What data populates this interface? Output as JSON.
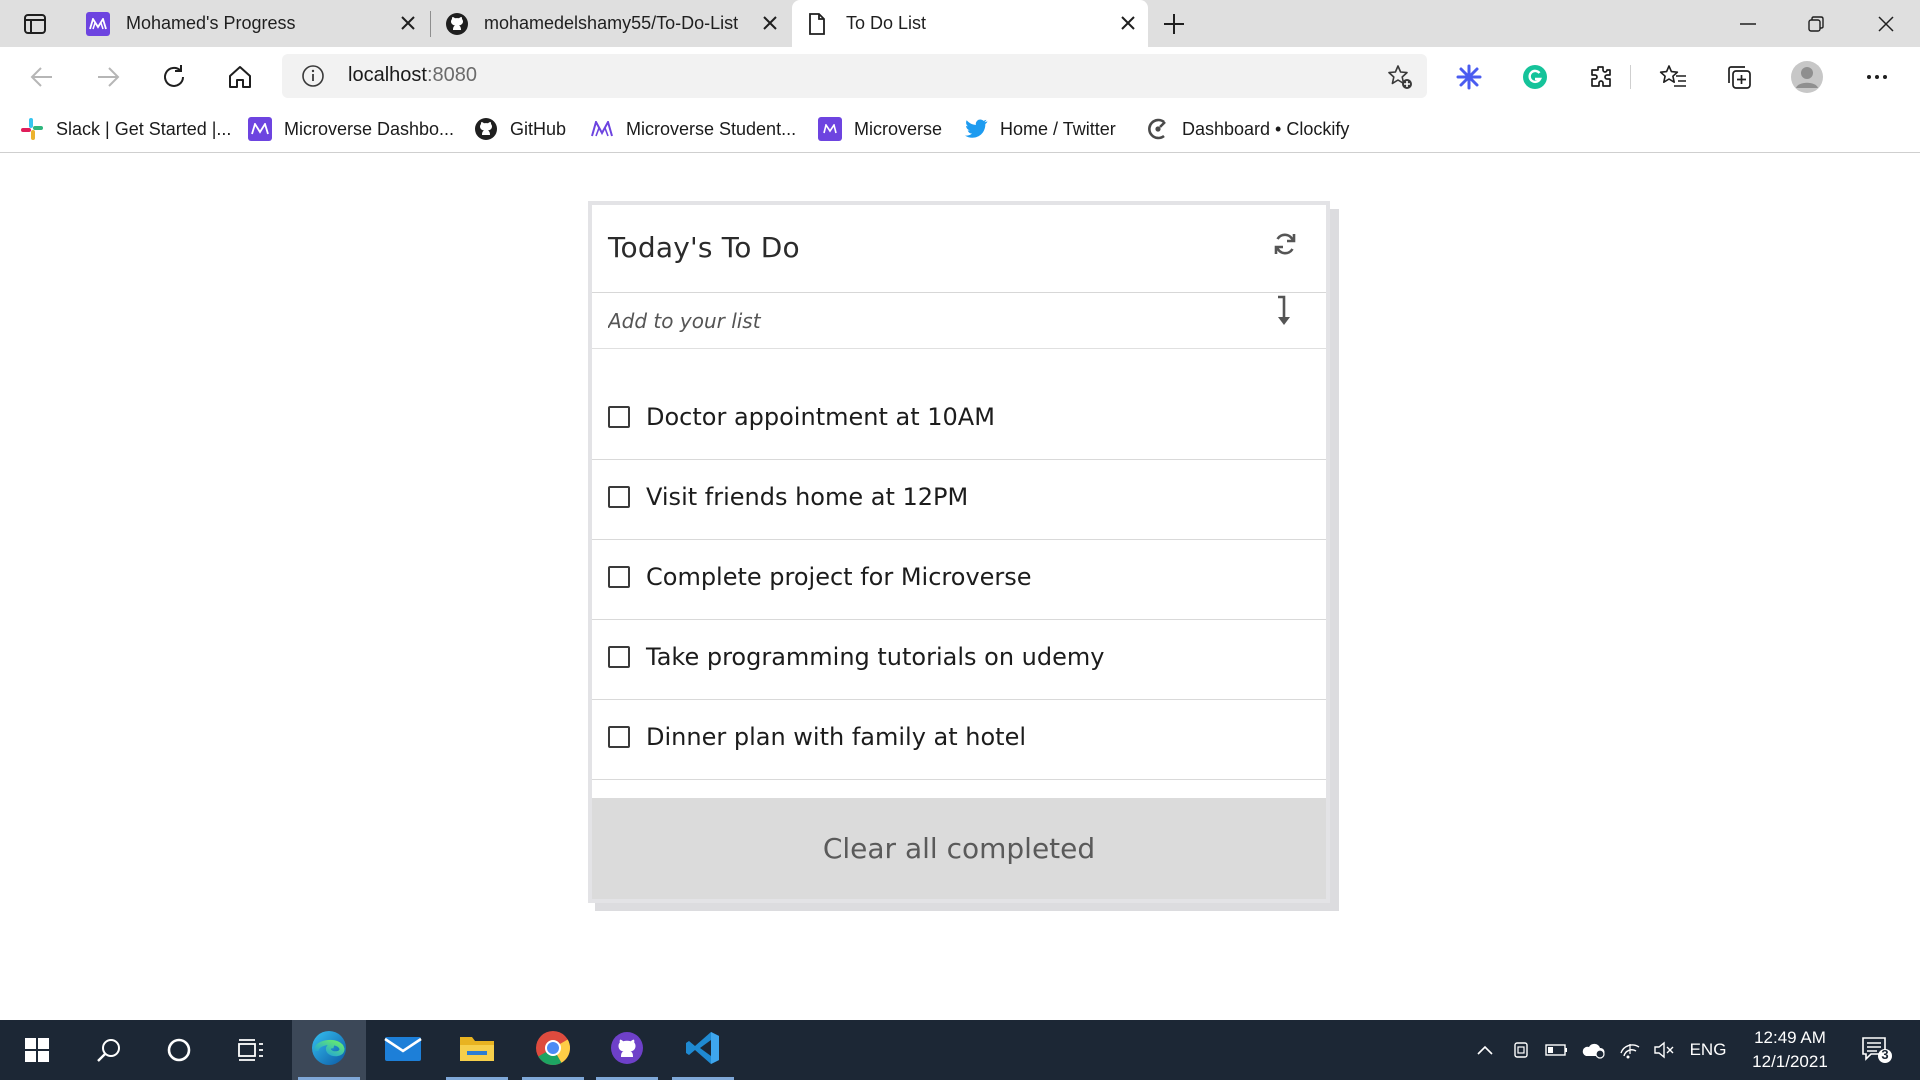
{
  "browser": {
    "tabs": [
      {
        "title": "Mohamed's Progress",
        "icon": "microverse-icon",
        "active": false
      },
      {
        "title": "mohamedelshamy55/To-Do-List",
        "icon": "github-icon",
        "active": false
      },
      {
        "title": "To Do List",
        "icon": "page-icon",
        "active": true
      }
    ],
    "address": {
      "host": "localhost",
      "port": ":8080"
    },
    "bookmarks": [
      {
        "label": "Slack | Get Started |...",
        "icon": "slack-icon"
      },
      {
        "label": "Microverse Dashbo...",
        "icon": "microverse-icon"
      },
      {
        "label": "GitHub",
        "icon": "github-icon"
      },
      {
        "label": "Microverse Student...",
        "icon": "microverse-icon"
      },
      {
        "label": "Microverse",
        "icon": "microverse-icon"
      },
      {
        "label": "Home / Twitter",
        "icon": "twitter-icon"
      },
      {
        "label": "Dashboard • Clockify",
        "icon": "clockify-icon"
      }
    ]
  },
  "todo": {
    "title": "Today's To Do",
    "add_placeholder": "Add to your list",
    "items": [
      {
        "label": "Doctor appointment at 10AM",
        "completed": false
      },
      {
        "label": "Visit friends home at 12PM",
        "completed": false
      },
      {
        "label": "Complete project for Microverse",
        "completed": false
      },
      {
        "label": "Take programming tutorials on udemy",
        "completed": false
      },
      {
        "label": "Dinner plan with family at hotel",
        "completed": false
      }
    ],
    "clear_label": "Clear all completed"
  },
  "taskbar": {
    "language": "ENG",
    "time": "12:49 AM",
    "date": "12/1/2021",
    "notification_count": "3"
  },
  "colors": {
    "brand_microverse": "#6d44e0",
    "taskbar_bg": "#1c2735",
    "clear_button_bg": "#dbdbdb",
    "twitter": "#1d9bf0"
  }
}
